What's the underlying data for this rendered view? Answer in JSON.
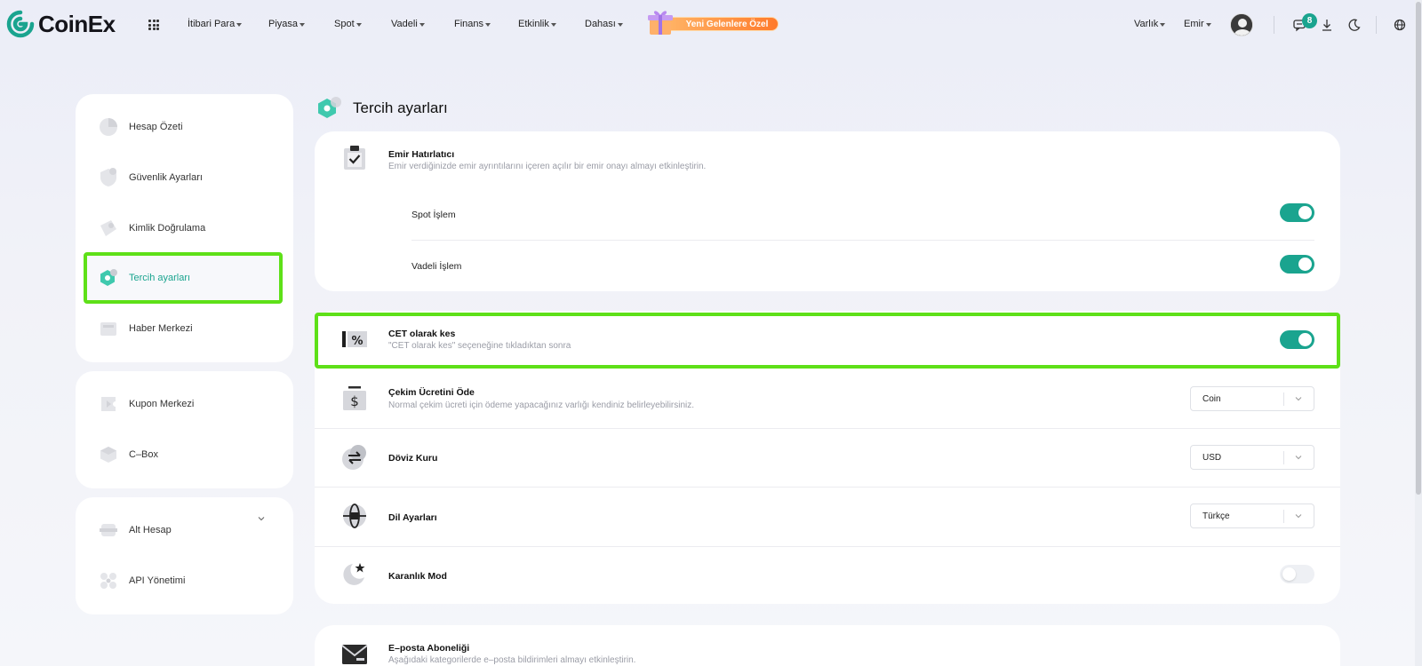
{
  "brand": {
    "name": "CoinEx"
  },
  "nav": {
    "items": [
      "İtibari Para",
      "Piyasa",
      "Spot",
      "Vadeli",
      "Finans",
      "Etkinlik",
      "Dahası"
    ],
    "promo": "Yeni Gelenlere Özel",
    "right": [
      "Varlık",
      "Emir"
    ],
    "notification_count": "8"
  },
  "sidebar": {
    "group1": [
      "Hesap Özeti",
      "Güvenlik Ayarları",
      "Kimlik Doğrulama",
      "Tercih ayarları",
      "Haber Merkezi"
    ],
    "group2": [
      "Kupon Merkezi",
      "C–Box"
    ],
    "group3": [
      "Alt Hesap",
      "API Yönetimi"
    ],
    "active": "Tercih ayarları"
  },
  "page": {
    "title": "Tercih ayarları",
    "order_reminder": {
      "title": "Emir Hatırlatıcı",
      "desc": "Emir verdiğinizde emir ayrıntılarını içeren açılır bir emir onayı almayı etkinleştirin.",
      "spot": {
        "label": "Spot İşlem",
        "enabled": true
      },
      "futures": {
        "label": "Vadeli İşlem",
        "enabled": true
      }
    },
    "cet": {
      "title": "CET olarak kes",
      "desc": "\"CET olarak kes\" seçeneğine tıkladıktan sonra",
      "enabled": true
    },
    "withdraw_fee": {
      "title": "Çekim Ücretini Öde",
      "desc": "Normal çekim ücreti için ödeme yapacağınız varlığı kendiniz belirleyebilirsiniz.",
      "value": "Coin"
    },
    "currency": {
      "title": "Döviz Kuru",
      "value": "USD"
    },
    "language": {
      "title": "Dil Ayarları",
      "value": "Türkçe"
    },
    "dark_mode": {
      "title": "Karanlık Mod",
      "enabled": false
    },
    "email_sub": {
      "title": "E–posta Aboneliği",
      "desc": "Aşağıdaki kategorilerde e–posta bildirimleri almayı etkinleştirin."
    }
  },
  "colors": {
    "accent": "#1aa48f",
    "highlight": "#5ee018",
    "promo": "#ff7a2b"
  }
}
